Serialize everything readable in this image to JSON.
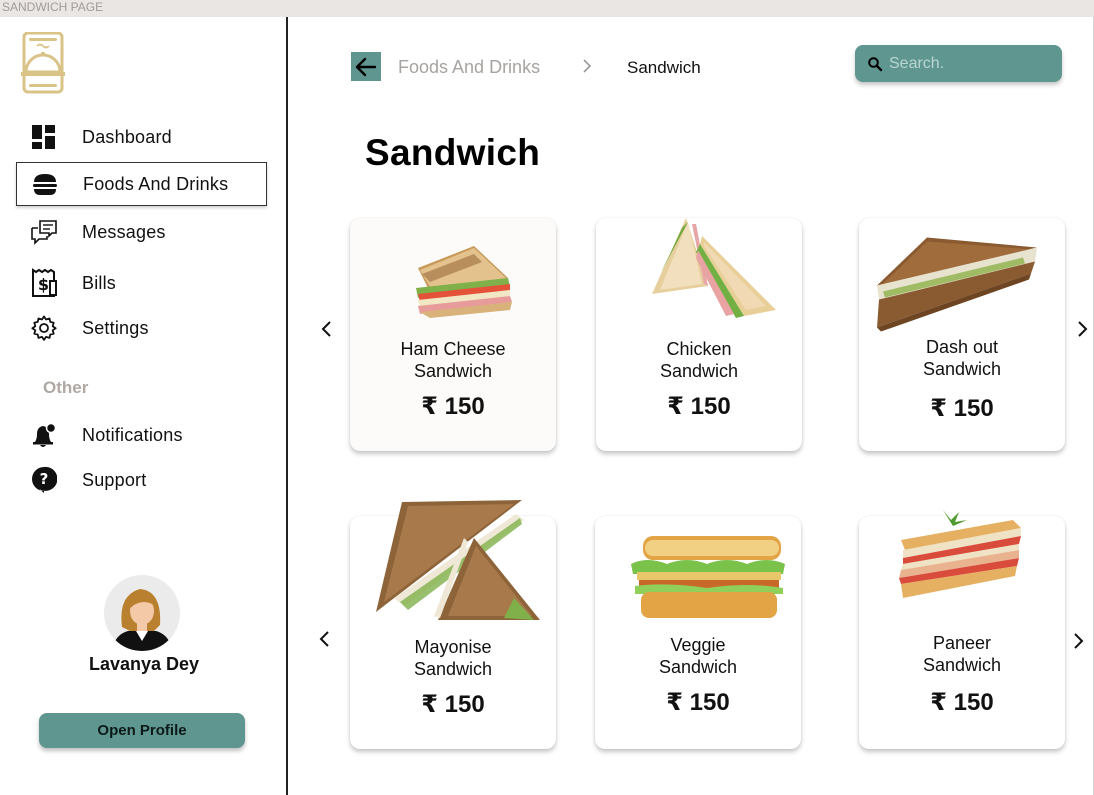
{
  "window": {
    "title": "SANDWICH PAGE"
  },
  "sidebar": {
    "items": [
      {
        "label": "Dashboard",
        "icon": "dashboard-icon"
      },
      {
        "label": "Foods And Drinks",
        "icon": "burger-icon",
        "active": true
      },
      {
        "label": "Messages",
        "icon": "messages-icon"
      },
      {
        "label": "Bills",
        "icon": "bill-icon"
      },
      {
        "label": "Settings",
        "icon": "gear-icon"
      }
    ],
    "other_label": "Other",
    "other_items": [
      {
        "label": "Notifications",
        "icon": "bell-icon"
      },
      {
        "label": "Support",
        "icon": "help-icon"
      }
    ],
    "user": {
      "name": "Lavanya Dey"
    },
    "open_profile": "Open Profile"
  },
  "header": {
    "breadcrumb_parent": "Foods And Drinks",
    "breadcrumb_current": "Sandwich",
    "search_placeholder": "Search."
  },
  "page_title": "Sandwich",
  "products": [
    {
      "name_1": "Ham Cheese",
      "name_2": "Sandwich",
      "price": "₹ 150"
    },
    {
      "name_1": "Chicken",
      "name_2": "Sandwich",
      "price": "₹ 150"
    },
    {
      "name_1": "Dash out",
      "name_2": "Sandwich",
      "price": "₹ 150"
    },
    {
      "name_1": "Mayonise",
      "name_2": "Sandwich",
      "price": "₹ 150"
    },
    {
      "name_1": "Veggie",
      "name_2": "Sandwich",
      "price": "₹ 150"
    },
    {
      "name_1": "Paneer",
      "name_2": "Sandwich",
      "price": "₹ 150"
    }
  ],
  "colors": {
    "accent": "#5f9690",
    "logo": "#d9c387",
    "muted_text": "#a7a3a1"
  }
}
